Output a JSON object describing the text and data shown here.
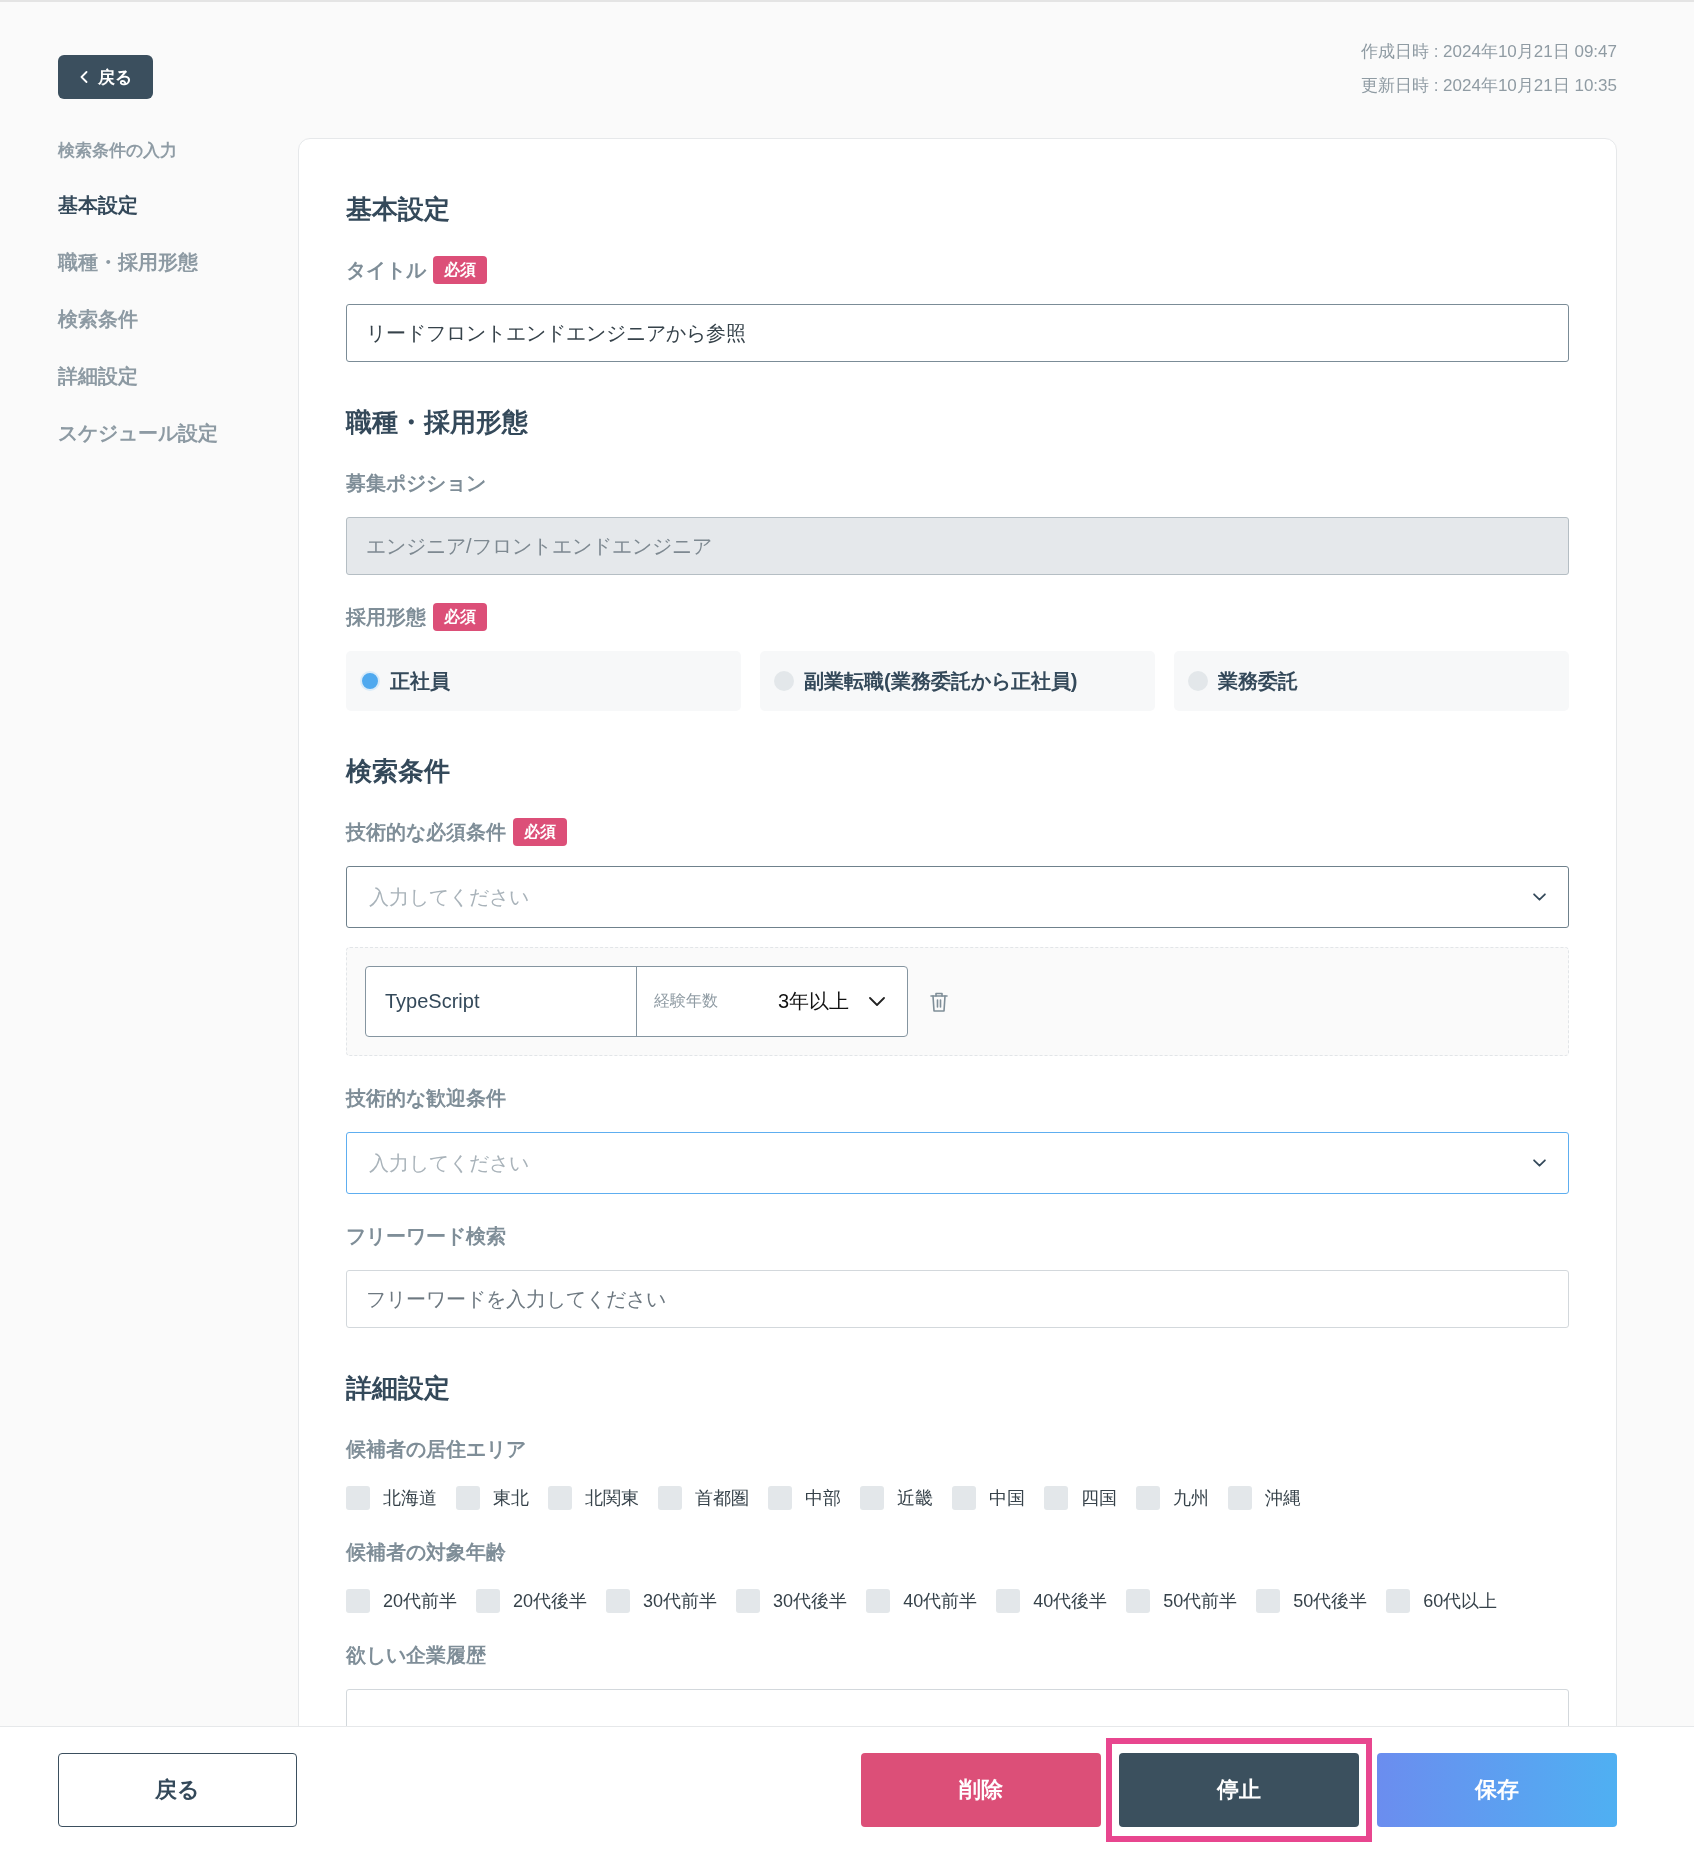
{
  "back_button": {
    "label": "戻る"
  },
  "timestamps": [
    "作成日時 : 2024年10月21日 09:47",
    "更新日時 : 2024年10月21日 10:35"
  ],
  "sidebar": {
    "title": "検索条件の入力",
    "items": [
      {
        "label": "基本設定",
        "selected": true
      },
      {
        "label": "職種・採用形態",
        "selected": false
      },
      {
        "label": "検索条件",
        "selected": false
      },
      {
        "label": "詳細設定",
        "selected": false
      },
      {
        "label": "スケジュール設定",
        "selected": false
      }
    ]
  },
  "sections": [
    {
      "heading": "基本設定",
      "fields": [
        {
          "kind": "text",
          "label": "タイトル",
          "badge": "必須",
          "value": "リードフロントエンドエンジニアから参照",
          "disabled": false
        }
      ]
    },
    {
      "heading": "職種・採用形態",
      "fields": [
        {
          "kind": "text",
          "label": "募集ポジション",
          "value": "エンジニア/フロントエンドエンジニア",
          "disabled": true
        },
        {
          "kind": "radio",
          "label": "採用形態",
          "badge": "必須",
          "options": [
            {
              "label": "正社員",
              "selected": true
            },
            {
              "label": "副業転職(業務委託から正社員)",
              "selected": false
            },
            {
              "label": "業務委託",
              "selected": false
            }
          ]
        }
      ]
    },
    {
      "heading": "検索条件",
      "fields": [
        {
          "kind": "select",
          "label": "技術的な必須条件",
          "badge": "必須",
          "placeholder": "入力してください",
          "focused": false,
          "skills": [
            {
              "name": "TypeScript",
              "experience_label": "経験年数",
              "experience": "3年以上"
            }
          ]
        },
        {
          "kind": "select",
          "label": "技術的な歓迎条件",
          "placeholder": "入力してください",
          "focused": true
        },
        {
          "kind": "text",
          "label": "フリーワード検索",
          "placeholder": "フリーワードを入力してください",
          "disabled": false
        }
      ]
    },
    {
      "heading": "詳細設定",
      "fields": [
        {
          "kind": "checkboxes",
          "label": "候補者の居住エリア",
          "options": [
            {
              "label": "北海道",
              "checked": false
            },
            {
              "label": "東北",
              "checked": false
            },
            {
              "label": "北関東",
              "checked": false
            },
            {
              "label": "首都圏",
              "checked": false
            },
            {
              "label": "中部",
              "checked": false
            },
            {
              "label": "近畿",
              "checked": false
            },
            {
              "label": "中国",
              "checked": false
            },
            {
              "label": "四国",
              "checked": false
            },
            {
              "label": "九州",
              "checked": false
            },
            {
              "label": "沖縄",
              "checked": false
            }
          ]
        },
        {
          "kind": "checkboxes",
          "label": "候補者の対象年齢",
          "options": [
            {
              "label": "20代前半",
              "checked": false
            },
            {
              "label": "20代後半",
              "checked": false
            },
            {
              "label": "30代前半",
              "checked": false
            },
            {
              "label": "30代後半",
              "checked": false
            },
            {
              "label": "40代前半",
              "checked": false
            },
            {
              "label": "40代後半",
              "checked": false
            },
            {
              "label": "50代前半",
              "checked": false
            },
            {
              "label": "50代後半",
              "checked": false
            },
            {
              "label": "60代以上",
              "checked": false
            }
          ]
        },
        {
          "kind": "text",
          "label": "欲しい企業履歴",
          "disabled": false
        }
      ]
    }
  ],
  "footer": {
    "back": {
      "label": "戻る"
    },
    "actions": [
      {
        "label": "削除",
        "kind": "danger",
        "highlighted": false
      },
      {
        "label": "停止",
        "kind": "dark",
        "highlighted": true
      },
      {
        "label": "保存",
        "kind": "primary",
        "highlighted": false
      }
    ]
  }
}
